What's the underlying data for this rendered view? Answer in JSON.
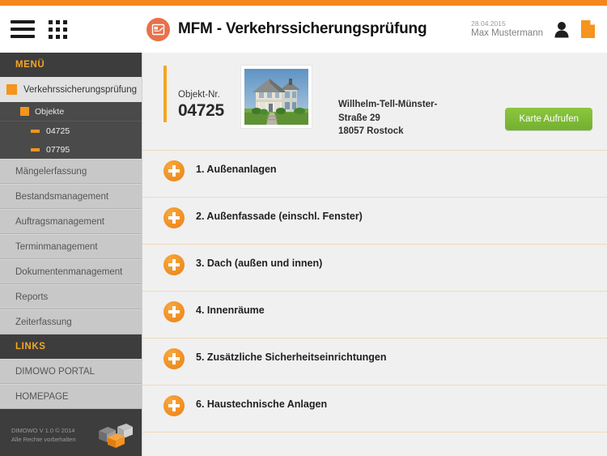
{
  "topbar": {
    "color": "#f5851f"
  },
  "header": {
    "menu_icon": "hamburger-icon",
    "apps_icon": "grid-apps-icon",
    "app_badge_icon": "clipboard-edit-icon",
    "title": "MFM - Verkehrssicherungsprüfung",
    "date": "28.04.2015",
    "user_name": "Max Mustermann",
    "profile_icon": "person-icon",
    "document_icon": "document-icon"
  },
  "sidebar": {
    "menu_heading": "MENÜ",
    "active_item": {
      "label": "Verkehrssicherungsprüfung"
    },
    "objects_group": {
      "label": "Objekte"
    },
    "objects": [
      {
        "label": "04725"
      },
      {
        "label": "07795"
      }
    ],
    "items": [
      {
        "label": "Mängelerfassung"
      },
      {
        "label": "Bestandsmanagement"
      },
      {
        "label": "Auftragsmanagement"
      },
      {
        "label": "Terminmanagement"
      },
      {
        "label": "Dokumentenmanagement"
      },
      {
        "label": "Reports"
      },
      {
        "label": "Zeiterfassung"
      }
    ],
    "links_heading": "LINKS",
    "links": [
      {
        "label": "DIMOWO PORTAL"
      },
      {
        "label": "HOMEPAGE"
      }
    ],
    "footer_line1": "DIMOWO V 1.0 © 2014",
    "footer_line2": "Alle Rechte vorbehalten",
    "footer_logo_icon": "cubes-logo-icon",
    "accent_color": "#f5941e",
    "background_color": "#3d3d3d"
  },
  "object_card": {
    "number_label": "Objekt-Nr.",
    "number_value": "04725",
    "thumbnail_icon": "house-photo",
    "address_line1": "Willhelm-Tell-Münster-",
    "address_line2": "Straße 29",
    "address_line3": "18057 Rostock",
    "map_button_label": "Karte Aufrufen",
    "map_button_color": "#7fbb35"
  },
  "checklist": {
    "items": [
      {
        "label": "1. Außenanlagen",
        "icon": "plus-circle-icon"
      },
      {
        "label": "2. Außenfassade (einschl. Fenster)",
        "icon": "plus-circle-icon"
      },
      {
        "label": "3. Dach (außen und innen)",
        "icon": "plus-circle-icon"
      },
      {
        "label": "4. Innenräume",
        "icon": "plus-circle-icon"
      },
      {
        "label": "5. Zusätzliche Sicherheitseinrichtungen",
        "icon": "plus-circle-icon"
      },
      {
        "label": "6. Haustechnische Anlagen",
        "icon": "plus-circle-icon"
      }
    ]
  }
}
